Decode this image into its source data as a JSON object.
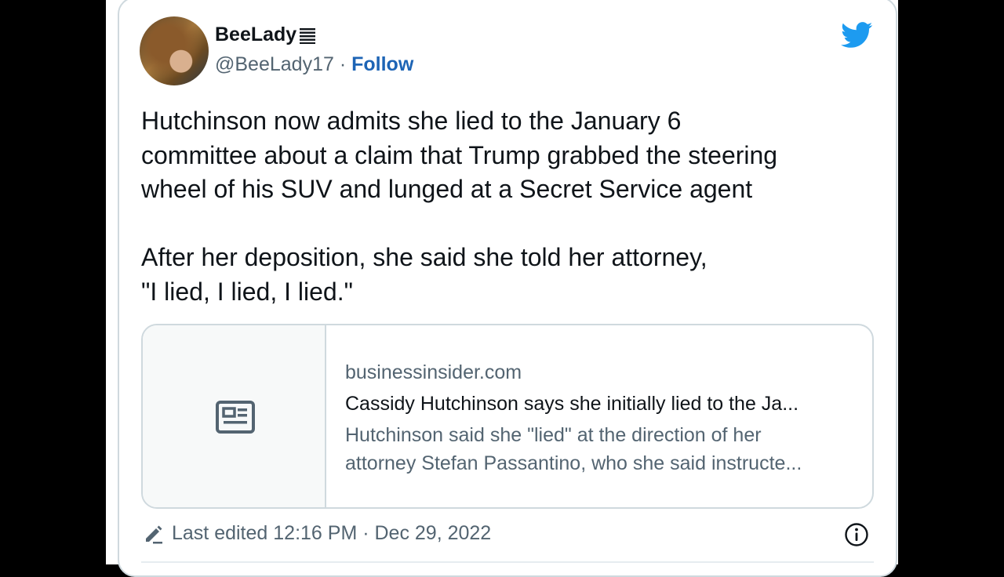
{
  "tweet": {
    "display_name": "BeeLady",
    "handle": "@BeeLady17",
    "separator": "·",
    "follow_label": "Follow",
    "text_paragraph_1_lines": [
      "Hutchinson now admits she lied to the January 6",
      "committee about a claim that Trump grabbed the steering",
      "wheel of his SUV and lunged at a Secret Service agent"
    ],
    "text_paragraph_2_lines": [
      "After her deposition, she said she told her attorney,",
      "\"I lied, I lied, I lied.\""
    ],
    "link_card": {
      "domain": "businessinsider.com",
      "title": "Cassidy Hutchinson says she initially lied to the Ja...",
      "description_lines": [
        "Hutchinson said she \"lied\" at the direction of her",
        "attorney Stefan Passantino, who she said instructe..."
      ],
      "thumbnail_icon": "news-article-icon"
    },
    "edited_label": "Last edited 12:16 PM · Dec 29, 2022"
  },
  "icons": {
    "brand": "twitter-bird-icon",
    "edit": "pencil-icon",
    "info": "info-icon"
  },
  "colors": {
    "twitter_blue": "#1d9bf0",
    "follow_blue": "#1d64b5",
    "text_primary": "#0f1419",
    "text_secondary": "#536471",
    "border": "#cfd9de"
  }
}
